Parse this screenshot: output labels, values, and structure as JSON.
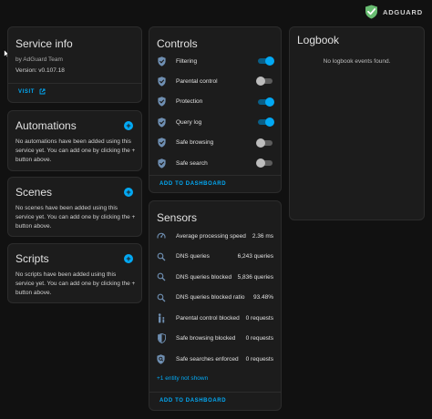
{
  "brand": {
    "logo_text": "ADGUARD"
  },
  "service_info": {
    "title": "Service info",
    "author": "by AdGuard Team",
    "version": "Version: v0.107.18",
    "visit_label": "VISIT"
  },
  "automations": {
    "title": "Automations",
    "empty_text": "No automations have been added using this service yet. You can add one by clicking the + button above."
  },
  "scenes": {
    "title": "Scenes",
    "empty_text": "No scenes have been added using this service yet. You can add one by clicking the + button above."
  },
  "scripts": {
    "title": "Scripts",
    "empty_text": "No scripts have been added using this service yet. You can add one by clicking the + button above."
  },
  "controls": {
    "title": "Controls",
    "items": [
      {
        "label": "Filtering",
        "on": true,
        "icon": "shield-check-icon"
      },
      {
        "label": "Parental control",
        "on": false,
        "icon": "shield-check-icon"
      },
      {
        "label": "Protection",
        "on": true,
        "icon": "shield-check-icon"
      },
      {
        "label": "Query log",
        "on": true,
        "icon": "shield-check-icon"
      },
      {
        "label": "Safe browsing",
        "on": false,
        "icon": "shield-check-icon"
      },
      {
        "label": "Safe search",
        "on": false,
        "icon": "shield-check-icon"
      }
    ],
    "add_label": "ADD TO DASHBOARD"
  },
  "sensors": {
    "title": "Sensors",
    "items": [
      {
        "label": "Average processing speed",
        "value": "2.36 ms",
        "icon": "speedometer-icon"
      },
      {
        "label": "DNS queries",
        "value": "6,243 queries",
        "icon": "magnify-icon"
      },
      {
        "label": "DNS queries blocked",
        "value": "5,836 queries",
        "icon": "magnify-icon"
      },
      {
        "label": "DNS queries blocked ratio",
        "value": "93.48%",
        "icon": "magnify-icon"
      },
      {
        "label": "Parental control blocked",
        "value": "0 requests",
        "icon": "parent-child-icon"
      },
      {
        "label": "Safe browsing blocked",
        "value": "0 requests",
        "icon": "shield-half-icon"
      },
      {
        "label": "Safe searches enforced",
        "value": "0 requests",
        "icon": "shield-search-icon"
      }
    ],
    "more_entities": "+1 entity not shown",
    "add_label": "ADD TO DASHBOARD"
  },
  "logbook": {
    "title": "Logbook",
    "empty_text": "No logbook events found."
  },
  "colors": {
    "accent": "#03a9f4",
    "background": "#111111",
    "card": "#1c1c1c",
    "brand_green": "#68bc71"
  }
}
